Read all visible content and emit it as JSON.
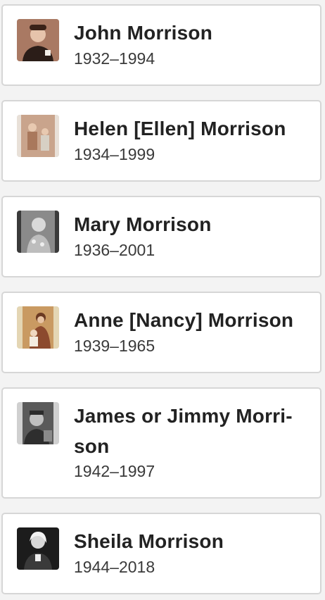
{
  "people": [
    {
      "name": "John Morrison",
      "dates": "1932–1994",
      "photo_tone": "#b98a73",
      "photo_icon": "person-photo-icon"
    },
    {
      "name": "Helen [Ellen] Morrison",
      "dates": "1934–1999",
      "photo_tone": "#c9a48c",
      "photo_icon": "person-photo-icon"
    },
    {
      "name": "Mary Morrison",
      "dates": "1936–2001",
      "photo_tone": "#8a8a8a",
      "photo_icon": "person-photo-icon"
    },
    {
      "name": "Anne [Nancy] Morrison",
      "dates": "1939–1965",
      "photo_tone": "#c99a62",
      "photo_icon": "person-photo-icon"
    },
    {
      "name": "James or Jimmy Morri-son",
      "name_line1": "James or Jimmy Morri-",
      "name_line2": "son",
      "dates": "1942–1997",
      "photo_tone": "#5a5a5a",
      "photo_icon": "person-photo-icon"
    },
    {
      "name": "Sheila Morrison",
      "dates": "1944–2018",
      "photo_tone": "#1c1c1c",
      "photo_icon": "person-photo-icon"
    }
  ]
}
